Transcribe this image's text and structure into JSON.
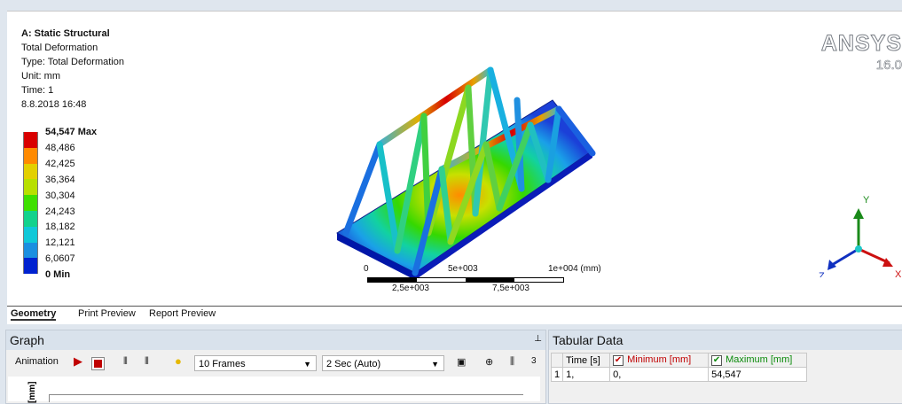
{
  "info": {
    "title": "A: Static Structural",
    "result": "Total Deformation",
    "type": "Type: Total Deformation",
    "unit": "Unit: mm",
    "time": "Time: 1",
    "date": "8.8.2018 16:48"
  },
  "legend": {
    "max_label": "54,547 Max",
    "min_label": "0 Min",
    "values": [
      "48,486",
      "42,425",
      "36,364",
      "30,304",
      "24,243",
      "18,182",
      "12,121",
      "6,0607"
    ],
    "colors": [
      "#d90000",
      "#ff8a00",
      "#e3d000",
      "#b8e000",
      "#3fe000",
      "#12d28c",
      "#10c8d8",
      "#1b8fe0",
      "#0022d0"
    ]
  },
  "branding": {
    "name": "ANSYS",
    "version": "16.0"
  },
  "scale": {
    "top": [
      "0",
      "5e+003",
      "1e+004 (mm)"
    ],
    "bottom": [
      "2,5e+003",
      "7,5e+003"
    ]
  },
  "triad": {
    "y": "Y",
    "z": "Z",
    "x": "X"
  },
  "tabs": [
    "Geometry",
    "Print Preview",
    "Report Preview"
  ],
  "graph": {
    "title": "Graph",
    "animation_label": "Animation",
    "frames": "10 Frames",
    "duration": "2 Sec (Auto)",
    "counter": "3",
    "axis_unit": "[mm]"
  },
  "tabular": {
    "title": "Tabular Data",
    "headers": [
      "Time [s]",
      "Minimum [mm]",
      "Maximum [mm]"
    ],
    "rows": [
      [
        "1",
        "1,",
        "0,",
        "54,547"
      ]
    ]
  }
}
